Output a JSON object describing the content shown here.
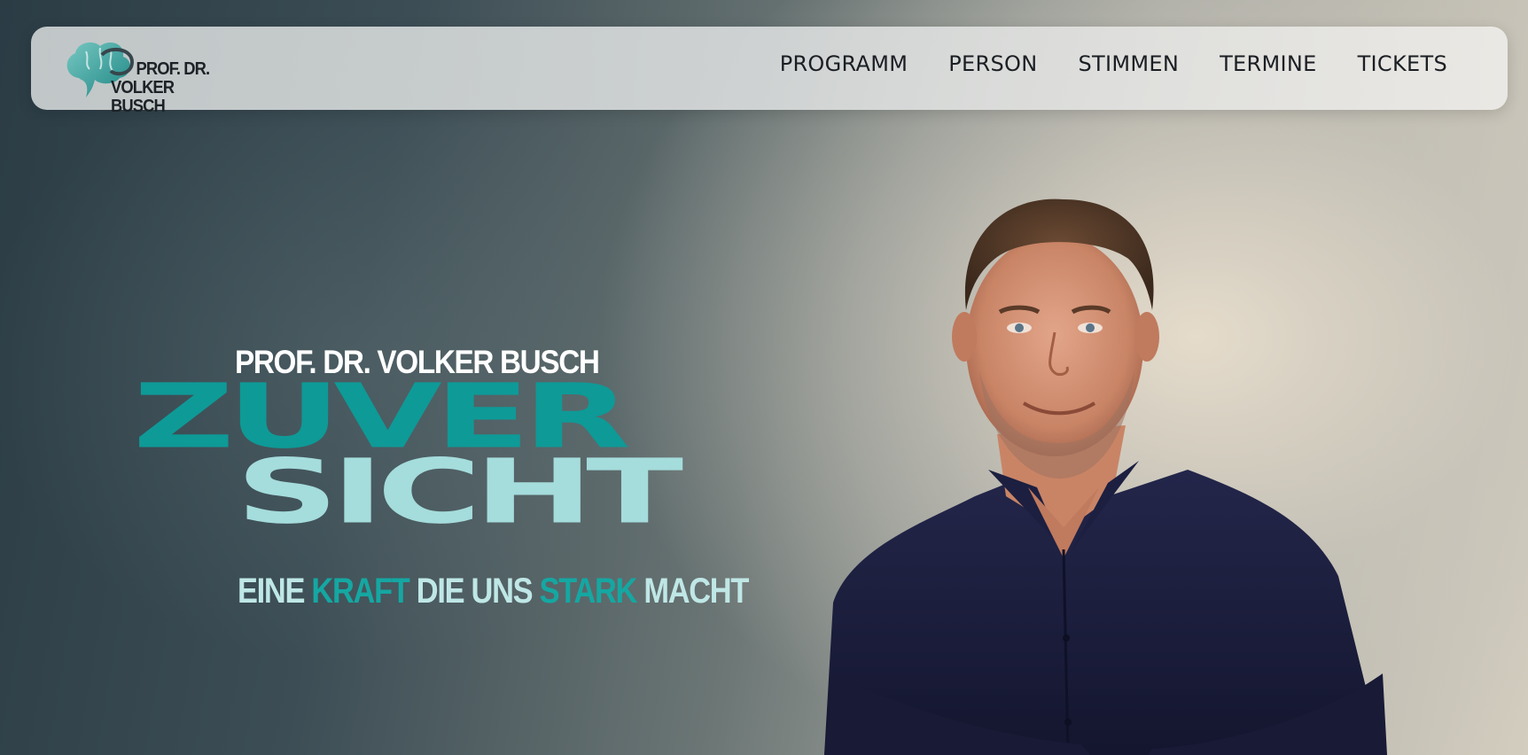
{
  "logo": {
    "line1": "PROF. DR.",
    "line2": "VOLKER BUSCH",
    "icon": "brain-speech-bubble-icon"
  },
  "nav": {
    "items": [
      {
        "label": "PROGRAMM"
      },
      {
        "label": "PERSON"
      },
      {
        "label": "STIMMEN"
      },
      {
        "label": "TERMINE"
      },
      {
        "label": "TICKETS"
      }
    ]
  },
  "hero": {
    "name": "PROF. DR. VOLKER BUSCH",
    "title_part1": "ZUVER",
    "title_part2": "SICHT",
    "tagline": {
      "w1": "EINE",
      "w2": "KRAFT",
      "w3": "DIE UNS",
      "w4": "STARK",
      "w5": "MACHT"
    }
  },
  "colors": {
    "accent": "#0e9a97",
    "accent_light": "#a5dcdc",
    "shirt": "#1a1d3d",
    "text_dark": "#1b1f24"
  }
}
